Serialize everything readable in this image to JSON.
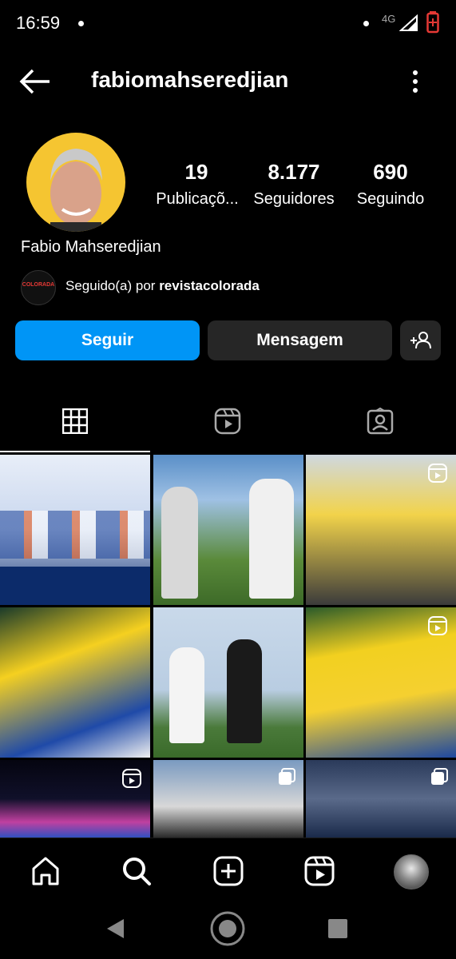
{
  "status_bar": {
    "time": "16:59",
    "network": "4G"
  },
  "header": {
    "username": "fabiomahseredjian"
  },
  "profile": {
    "stats": [
      {
        "value": "19",
        "label": "Publicaçõ..."
      },
      {
        "value": "8.177",
        "label": "Seguidores"
      },
      {
        "value": "690",
        "label": "Seguindo"
      }
    ],
    "full_name": "Fabio Mahseredjian",
    "followed_by_prefix": "Seguido(a) por ",
    "followed_by_user": "revistacolorada",
    "followed_avatar_text": "COLORADA"
  },
  "actions": {
    "follow": "Seguir",
    "message": "Mensagem"
  },
  "colors": {
    "accent": "#0095f6",
    "secondary_button": "#262626",
    "background": "#000000"
  },
  "tabs": [
    {
      "icon": "grid-icon",
      "active": true
    },
    {
      "icon": "reels-icon",
      "active": false
    },
    {
      "icon": "tagged-icon",
      "active": false
    }
  ],
  "posts": [
    {
      "type": "image"
    },
    {
      "type": "image"
    },
    {
      "type": "reel"
    },
    {
      "type": "image"
    },
    {
      "type": "image"
    },
    {
      "type": "reel"
    },
    {
      "type": "reel"
    },
    {
      "type": "carousel"
    },
    {
      "type": "carousel"
    }
  ],
  "bottom_nav": [
    "home-icon",
    "search-icon",
    "create-icon",
    "reels-icon",
    "profile-avatar"
  ]
}
